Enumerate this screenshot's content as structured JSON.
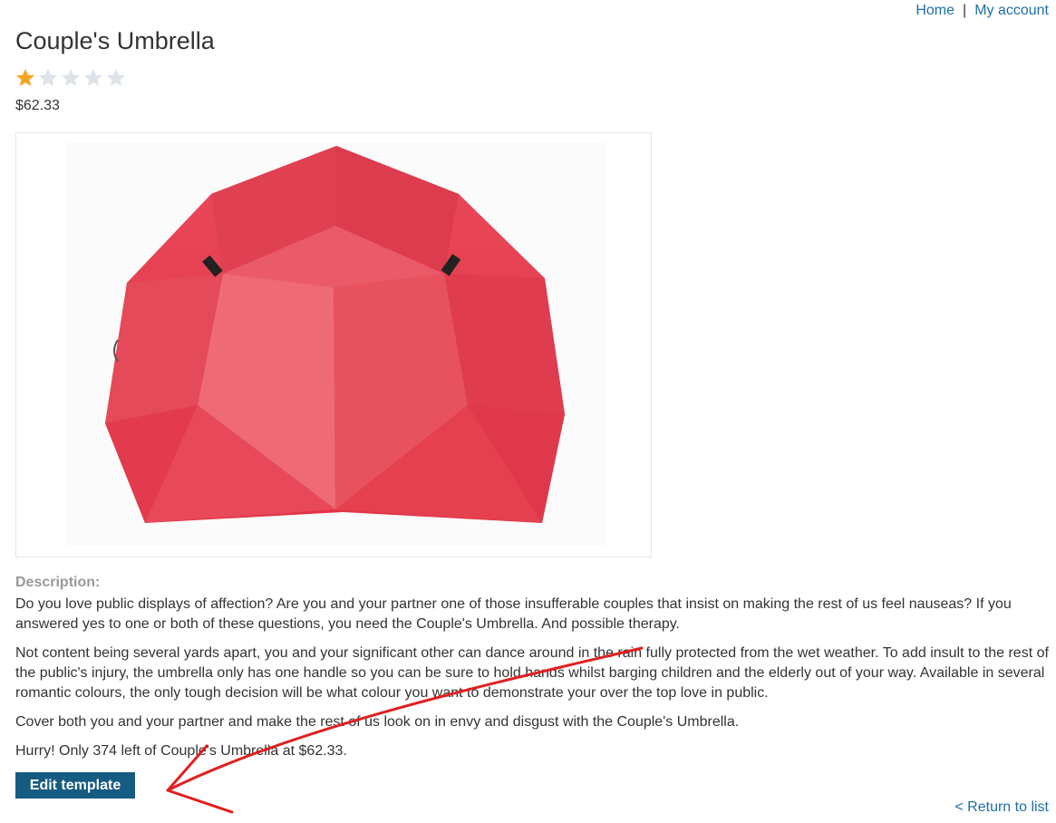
{
  "nav": {
    "home": "Home",
    "separator": "|",
    "account": "My account"
  },
  "product": {
    "title": "Couple's Umbrella",
    "rating": {
      "value": 1,
      "max": 5
    },
    "price": "$62.33",
    "image_icon": "red-umbrella-image"
  },
  "description": {
    "label": "Description:",
    "paragraphs": [
      "Do you love public displays of affection? Are you and your partner one of those insufferable couples that insist on making the rest of us feel nauseas? If you answered yes to one or both of these questions, you need the Couple's Umbrella. And possible therapy.",
      "Not content being several yards apart, you and your significant other can dance around in the rain fully protected from the wet weather. To add insult to the rest of the public's injury, the umbrella only has one handle so you can be sure to hold hands whilst barging children and the elderly out of your way. Available in several romantic colours, the only tough decision will be what colour you want to demonstrate your over the top love in public.",
      "Cover both you and your partner and make the rest of us look on in envy and disgust with the Couple's Umbrella.",
      "Hurry! Only 374 left of Couple's Umbrella at $62.33."
    ]
  },
  "actions": {
    "edit_template": "Edit template",
    "return": "< Return to list"
  },
  "colors": {
    "link": "#1d6ea6",
    "button": "#165b82",
    "star_on": "#f6a623",
    "star_off": "#dde3e8",
    "annotation": "#e02020"
  }
}
